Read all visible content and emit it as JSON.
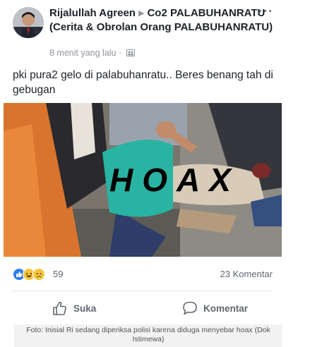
{
  "post": {
    "author": "Rijalullah Agreen",
    "group": "Co2 PALABUHANRATU (Cerita & Obrolan Orang PALABUHANRATU)",
    "timestamp": "8 menit yang lalu",
    "privacy_icon": "group-audience-icon",
    "more_icon": "more-options-icon",
    "text": "pki pura2 gelo di palabuhanratu.. Beres benang tah di gebugan",
    "image_overlay_text": "HOAX"
  },
  "stats": {
    "reactions": [
      "like",
      "haha",
      "sad"
    ],
    "reaction_count": "59",
    "comment_count": "23 Komentar"
  },
  "actions": {
    "like_label": "Suka",
    "comment_label": "Komentar"
  },
  "photo_caption": "Foto: Inisial Ri sedang diperiksa polisi karena diduga menyebar hoax (Dok Istimewa)",
  "colors": {
    "like_blue": "#2f7bf6",
    "emoji_yellow": "#f7c53c",
    "meta_gray": "#90949c"
  }
}
